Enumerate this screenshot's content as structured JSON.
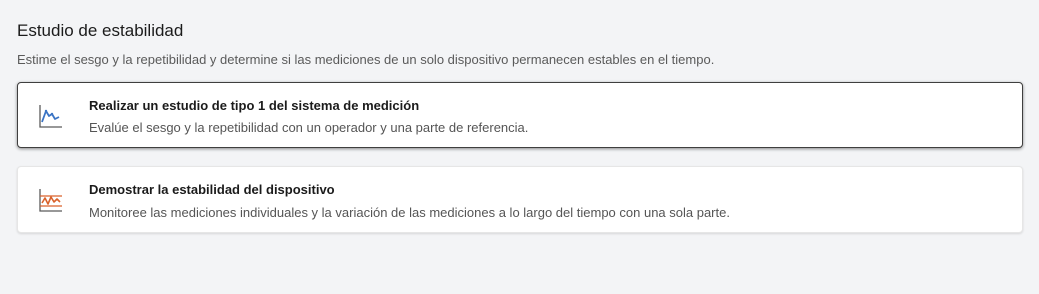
{
  "section": {
    "title": "Estudio de estabilidad",
    "description": "Estime el sesgo y la repetibilidad y determine si las mediciones de un solo dispositivo permanecen estables en el tiempo."
  },
  "options": [
    {
      "title": "Realizar un estudio de tipo 1 del sistema de medición",
      "description": "Evalúe el sesgo y la repetibilidad con un operador y una parte de referencia.",
      "icon": "run-chart-icon",
      "selected": true
    },
    {
      "title": "Demostrar la estabilidad del dispositivo",
      "description": "Monitoree las mediciones individuales y la variación de las mediciones a lo largo del tiempo con una sola parte.",
      "icon": "control-chart-icon",
      "selected": false
    }
  ],
  "colors": {
    "background": "#f3f4f6",
    "icon_blue": "#3b74c4",
    "icon_orange": "#d9622b",
    "axis_gray": "#5a5a5a"
  }
}
